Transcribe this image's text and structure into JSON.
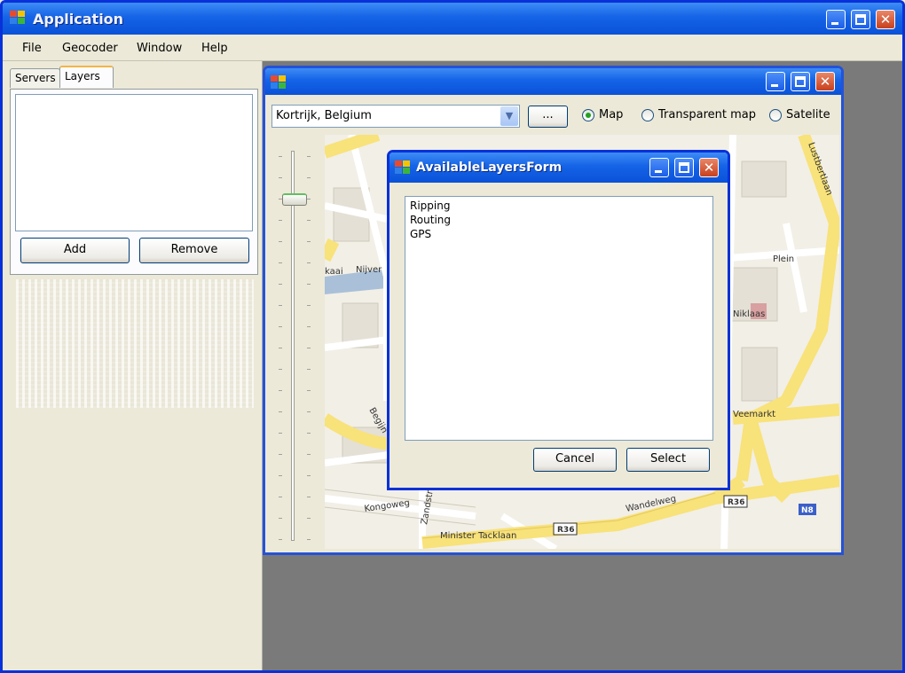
{
  "app": {
    "title": "Application",
    "menu": [
      "File",
      "Geocoder",
      "Window",
      "Help"
    ]
  },
  "left_panel": {
    "tabs": [
      "Servers",
      "Layers"
    ],
    "active_tab": "Layers",
    "add_label": "Add",
    "remove_label": "Remove"
  },
  "map_window": {
    "title": "",
    "location_value": "Kortrijk, Belgium",
    "browse_label": "...",
    "radio_options": [
      {
        "label": "Map",
        "selected": true
      },
      {
        "label": "Transparent map",
        "selected": false
      },
      {
        "label": "Satelite",
        "selected": false
      }
    ],
    "zoom_level": 0.89,
    "map_labels": {
      "street1": "Minister Tacklaan",
      "street2": "Wandelweg",
      "street3": "Kongoweg",
      "road_r36a": "R36",
      "road_r36b": "R36",
      "road_n8": "N8",
      "street4": "Veemarkt",
      "street5": "Niklaas",
      "street6": "Plein",
      "street7": "Zandstr",
      "street8": "Lustbertlaan",
      "street9": "kaai",
      "street10": "Nijver",
      "street11": "Begijn"
    }
  },
  "dialog": {
    "title": "AvailableLayersForm",
    "items": [
      "Ripping",
      "Routing",
      "GPS"
    ],
    "cancel_label": "Cancel",
    "select_label": "Select"
  },
  "colors": {
    "titlebar": "#0a52d8",
    "map_road": "#f8e27a",
    "map_bg": "#f2efe7",
    "mdi_bg": "#7a7a7a"
  }
}
